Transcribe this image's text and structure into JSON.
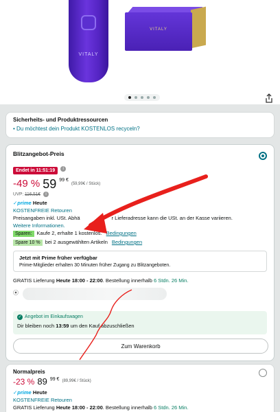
{
  "colors": {
    "accent_red": "#cc0c39",
    "teal": "#007185",
    "green": "#067d62",
    "annotation_red": "#e8201c"
  },
  "hero": {
    "device_brand": "VITALY",
    "box_brand": "VITALY",
    "carousel": {
      "count": 5,
      "active_index": 0
    },
    "share_icon": "share-icon"
  },
  "safety": {
    "heading": "Sicherheits- und Produktressourcen",
    "link": "Du möchtest dein Produkt KOSTENLOS recyceln?"
  },
  "offer": {
    "title": "Blitzangebot-Preis",
    "selected": true,
    "badge": "Endet in 11:51:19",
    "discount": "-49 %",
    "price_whole": "59",
    "price_fraction": "99 €",
    "unit_price": "(59,99€ / Stück)",
    "uvp_label": "UVP:",
    "uvp_value": "116,51€",
    "prime_label": "prime",
    "prime_day": "Heute",
    "returns": "KOSTENFREIE Retouren",
    "tax_text_a": "Preisangaben inkl. USt. Abhä",
    "tax_text_b": "r Lieferadresse kann die USt. an der Kasse variieren.",
    "more_info": "Weitere Informationen.",
    "save_tag": "Sparen:",
    "save_text": "Kaufe 2, erhalte 1 kostenlos.",
    "save_link": "Bedingungen",
    "spare_tag": "Spare 10 %",
    "spare_text": "bei 2 ausgewählten Artikeln",
    "spare_link": "Bedingungen",
    "prime_box_heading": "Jetzt mit Prime früher verfügbar",
    "prime_box_text": "Prime-Mitglieder erhalten 30 Minuten früher Zugang zu Blitzangeboten.",
    "delivery_a": "GRATIS Lieferung ",
    "delivery_b": "Heute 18:00 - 22:00",
    "delivery_c": ". Bestellung innerhalb ",
    "delivery_d": "6 Stdn. 26 Min.",
    "cart_status": "Angebot im Einkaufswagen",
    "timer_a": "Dir bleiben noch ",
    "timer_b": "13:59",
    "timer_c": " um den Kauf abzuschließen",
    "cart_button": "Zum Warenkorb"
  },
  "normal": {
    "title": "Normalpreis",
    "selected": false,
    "discount": "-23 %",
    "price_whole": "89",
    "price_fraction": "99 €",
    "unit_price": "(89,99€ / Stück)",
    "prime_label": "prime",
    "prime_day": "Heute",
    "returns": "KOSTENFREIE Retouren",
    "delivery_a": "GRATIS Lieferung ",
    "delivery_b": "Heute 18:00 - 22:00",
    "delivery_c": ". Bestellung innerhalb ",
    "delivery_d": "6 Stdn. 26 Min."
  }
}
